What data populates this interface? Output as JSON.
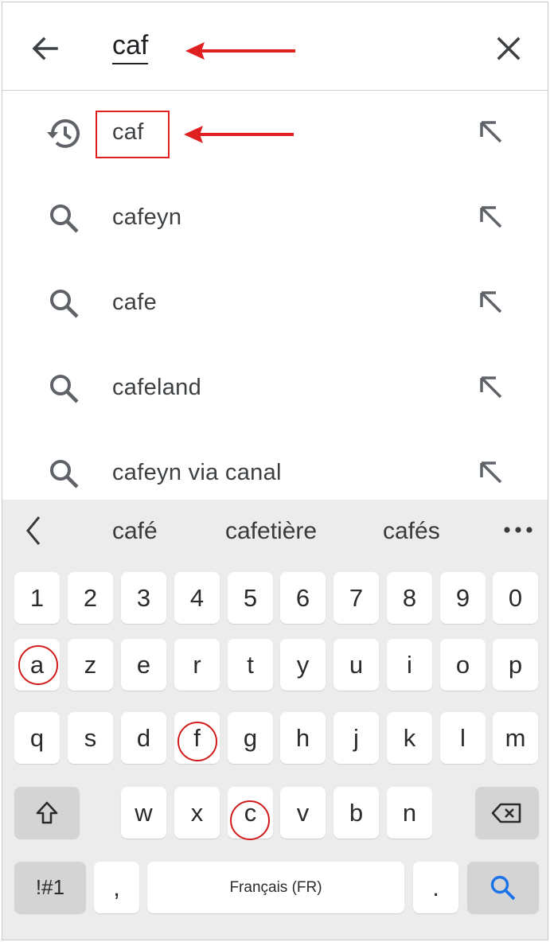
{
  "search": {
    "query": "caf",
    "back_icon": "arrow-left-icon",
    "clear_icon": "close-icon"
  },
  "suggestions": [
    {
      "text": "caf",
      "icon": "history-icon",
      "fill_icon": "arrow-up-left-icon"
    },
    {
      "text": "cafeyn",
      "icon": "search-icon",
      "fill_icon": "arrow-up-left-icon"
    },
    {
      "text": "cafe",
      "icon": "search-icon",
      "fill_icon": "arrow-up-left-icon"
    },
    {
      "text": "cafeland",
      "icon": "search-icon",
      "fill_icon": "arrow-up-left-icon"
    },
    {
      "text": "cafeyn via canal",
      "icon": "search-icon",
      "fill_icon": "arrow-up-left-icon"
    }
  ],
  "keyboard": {
    "suggestions": [
      "café",
      "cafetière",
      "cafés"
    ],
    "row_numbers": [
      "1",
      "2",
      "3",
      "4",
      "5",
      "6",
      "7",
      "8",
      "9",
      "0"
    ],
    "row1": [
      "a",
      "z",
      "e",
      "r",
      "t",
      "y",
      "u",
      "i",
      "o",
      "p"
    ],
    "row2": [
      "q",
      "s",
      "d",
      "f",
      "g",
      "h",
      "j",
      "k",
      "l",
      "m"
    ],
    "row3": [
      "w",
      "x",
      "c",
      "v",
      "b",
      "n"
    ],
    "symbols_label": "!#1",
    "comma_label": ",",
    "space_label": "Français (FR)",
    "period_label": ".",
    "search_key_icon": "search-icon",
    "shift_icon": "shift-icon",
    "backspace_icon": "backspace-icon"
  },
  "colors": {
    "annotation_red": "#e02020",
    "keyboard_bg": "#ececec",
    "search_key_blue": "#1a73e8",
    "icon_gray": "#5f6368"
  }
}
